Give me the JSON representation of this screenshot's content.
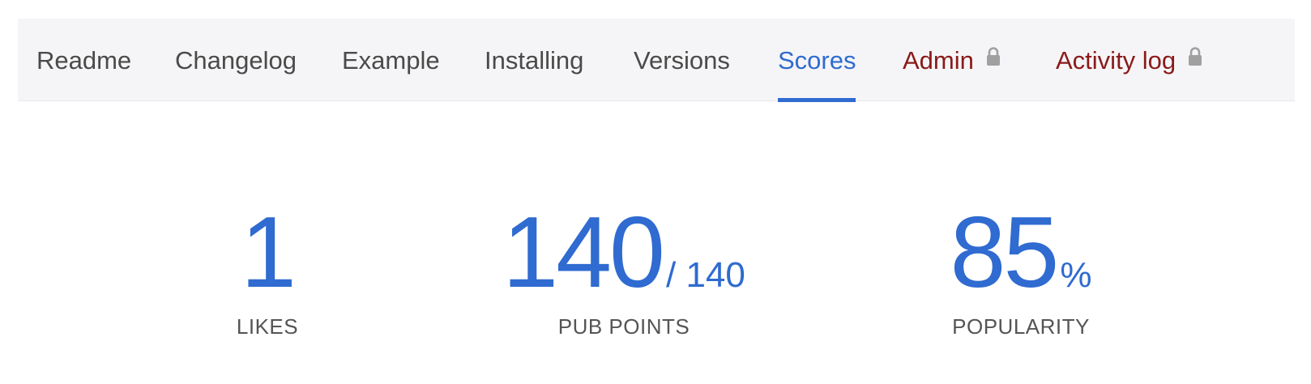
{
  "tabs": [
    {
      "label": "Readme",
      "state": "normal"
    },
    {
      "label": "Changelog",
      "state": "normal"
    },
    {
      "label": "Example",
      "state": "normal"
    },
    {
      "label": "Installing",
      "state": "normal"
    },
    {
      "label": "Versions",
      "state": "normal"
    },
    {
      "label": "Scores",
      "state": "active"
    },
    {
      "label": "Admin",
      "state": "restricted",
      "icon": "lock-icon"
    },
    {
      "label": "Activity log",
      "state": "restricted",
      "icon": "lock-icon"
    }
  ],
  "colors": {
    "accent": "#2f6bd0",
    "restricted": "#8a1a1a",
    "tab_text": "#4a4a4a",
    "caption": "#555555",
    "tabbar_bg": "#f5f5f7",
    "lock": "#a0a0a0"
  },
  "scores": {
    "likes": {
      "value": "1",
      "caption": "LIKES"
    },
    "pub_points": {
      "value": "140",
      "max": "/ 140",
      "caption": "PUB POINTS"
    },
    "popularity": {
      "value": "85",
      "unit": "%",
      "caption": "POPULARITY"
    }
  }
}
